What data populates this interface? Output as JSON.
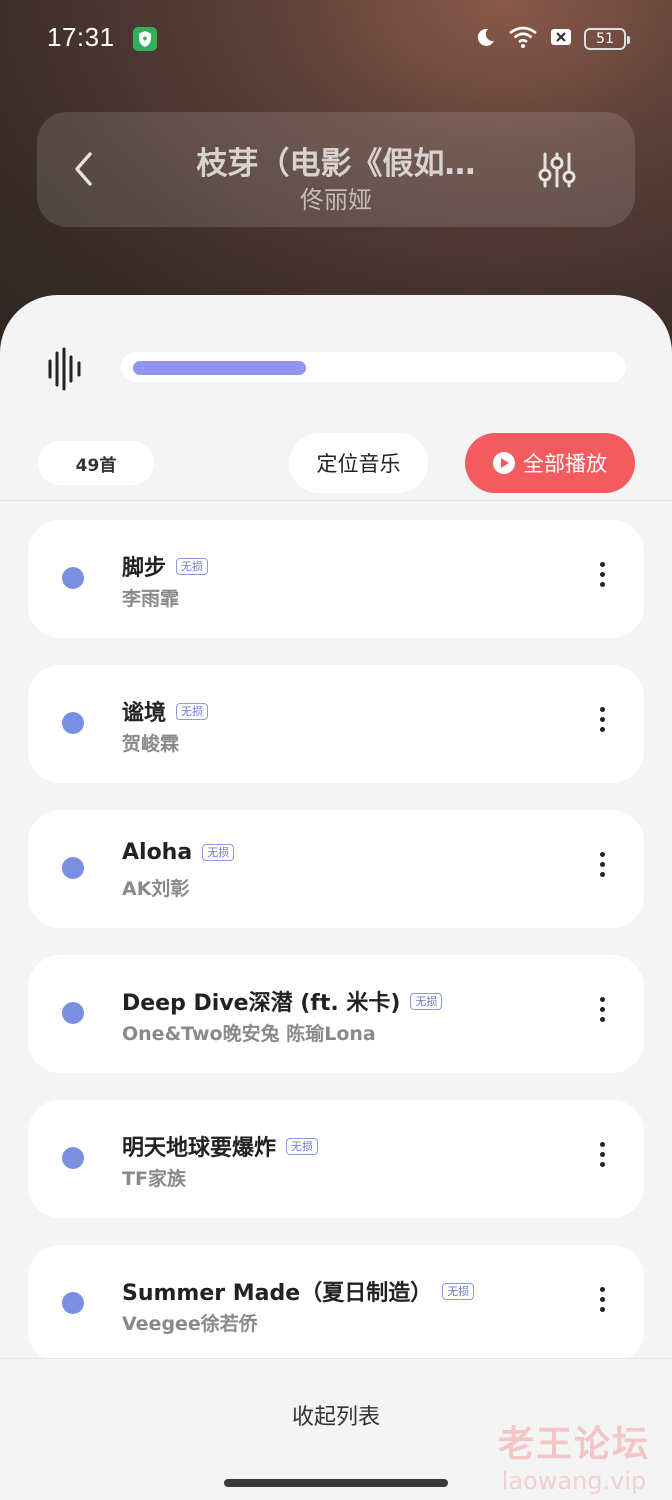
{
  "status_bar": {
    "time": "17:31",
    "battery": "51",
    "icons": [
      "shield-icon",
      "moon-icon",
      "wifi-icon",
      "close-box-icon",
      "battery-icon"
    ]
  },
  "header": {
    "title": "枝芽（电影《假如…",
    "artist": "佟丽娅"
  },
  "progress": {
    "fraction": 0.36,
    "fill_color": "#9096ef"
  },
  "controls": {
    "count": "49首",
    "locate_label": "定位音乐",
    "play_all_label": "全部播放",
    "accent": "#f25c5f"
  },
  "songs": [
    {
      "title": "脚步",
      "badge": "无损",
      "artist": "李雨霏"
    },
    {
      "title": "谧境",
      "badge": "无损",
      "artist": "贺峻霖"
    },
    {
      "title": "Aloha",
      "badge": "无损",
      "artist": "AK刘彰"
    },
    {
      "title": "Deep Dive深潜 (ft. 米卡)",
      "badge": "无损",
      "artist": "One&Two晚安兔 陈瑜Lona"
    },
    {
      "title": "明天地球要爆炸",
      "badge": "无损",
      "artist": "TF家族"
    },
    {
      "title": "Summer Made（夏日制造）",
      "badge": "无损",
      "artist": "Veegee徐若侨"
    }
  ],
  "footer": {
    "collapse_label": "收起列表",
    "watermark_cn": "老王论坛",
    "watermark_en": "laowang.vip"
  }
}
